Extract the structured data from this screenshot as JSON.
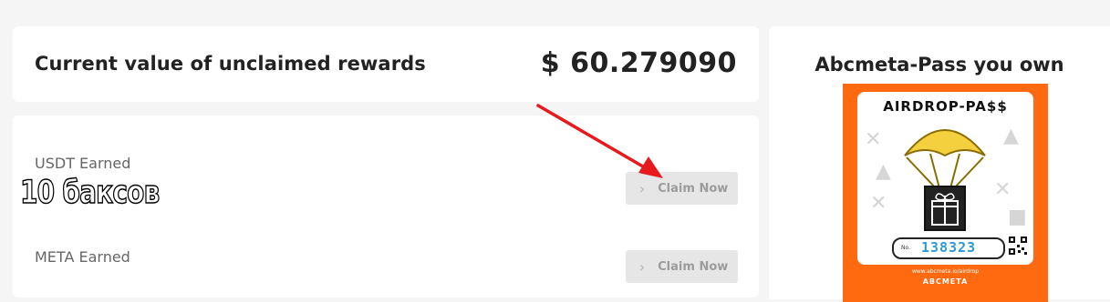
{
  "rewards": {
    "title": "Current value of unclaimed rewards",
    "amount": "$ 60.279090"
  },
  "earnings": [
    {
      "label": "USDT Earned",
      "button": "Claim Now"
    },
    {
      "label": "META Earned",
      "button": "Claim Now"
    }
  ],
  "overlay": {
    "text": "10 баксов",
    "color": "#ffffff",
    "outline": "#000000"
  },
  "annotation": {
    "arrow_color": "#e8191c"
  },
  "pass": {
    "title": "Abcmeta-Pass you own",
    "image": {
      "heading": "AIRDROP-PA$$",
      "no_label": "No.",
      "number": "138323",
      "url": "www.abcmeta.io/airdrop",
      "brand": "ABCMETA",
      "background": "#ff6a10"
    }
  },
  "colors": {
    "page_bg": "#f5f5f5",
    "card_bg": "#ffffff",
    "button_bg": "#e6e6e6",
    "button_text": "#9c9c9c"
  }
}
